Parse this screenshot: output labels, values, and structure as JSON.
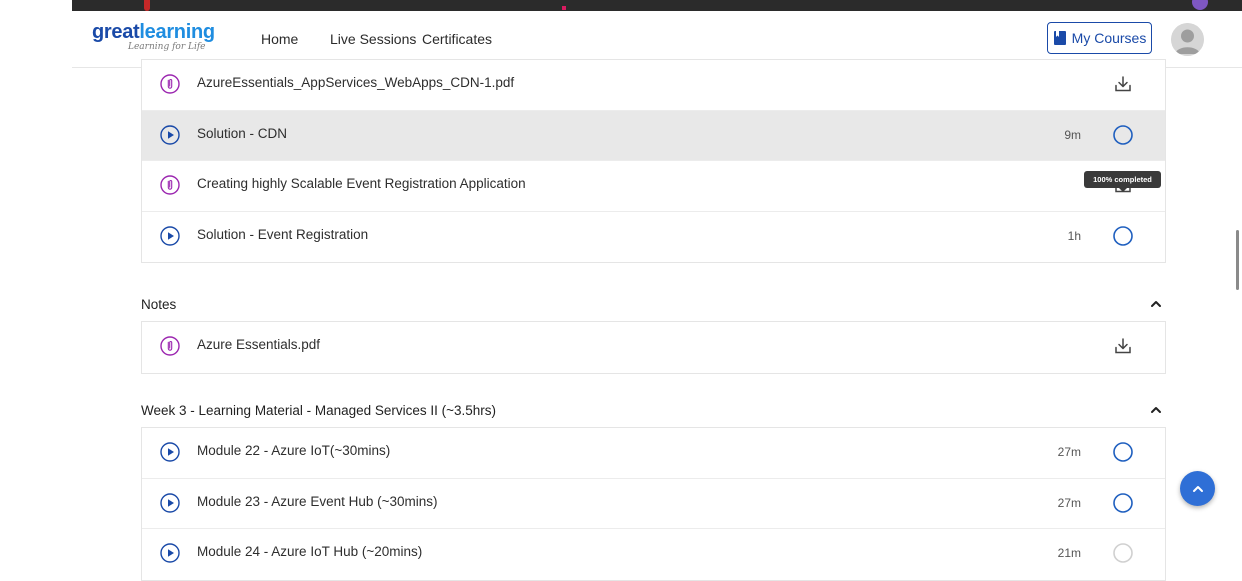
{
  "nav": {
    "logo_main_a": "great",
    "logo_main_b": "learning",
    "logo_tagline": "Learning for Life",
    "links": [
      "Home",
      "Live Sessions",
      "Certificates"
    ],
    "my_courses_label": "My Courses"
  },
  "colors": {
    "brand_dark": "#1a4aa8",
    "brand_light": "#1f8de0",
    "play_icon": "#1a4aa8",
    "attachment_icon": "#9c27b0",
    "status_ring": "#1f5fbf",
    "fab": "#2f6fd6"
  },
  "top_items": [
    {
      "type": "attachment",
      "icon": "paperclip-icon",
      "title": "AzureEssentials_AppServices_WebApps_CDN-1.pdf",
      "duration": "",
      "action": "download-icon"
    },
    {
      "type": "video",
      "icon": "play-icon",
      "title": "Solution - CDN",
      "duration": "9m",
      "action": "status-circle-icon",
      "highlighted": true
    },
    {
      "type": "attachment",
      "icon": "paperclip-icon",
      "title": "Creating highly Scalable Event Registration Application",
      "duration": "",
      "action": "download-icon"
    },
    {
      "type": "video",
      "icon": "play-icon",
      "title": "Solution - Event Registration",
      "duration": "1h",
      "action": "status-circle-icon"
    }
  ],
  "tooltip": "100% completed",
  "notes_section": {
    "label": "Notes",
    "items": [
      {
        "type": "attachment",
        "icon": "paperclip-icon",
        "title": "Azure Essentials.pdf",
        "action": "download-icon"
      }
    ]
  },
  "week3_section": {
    "label": "Week 3 - Learning Material - Managed Services II (~3.5hrs)",
    "items": [
      {
        "type": "video",
        "icon": "play-icon",
        "title": "Module 22 - Azure IoT(~30mins)",
        "duration": "27m"
      },
      {
        "type": "video",
        "icon": "play-icon",
        "title": "Module 23 - Azure Event Hub (~30mins)",
        "duration": "27m"
      },
      {
        "type": "video",
        "icon": "play-icon",
        "title": "Module 24 - Azure IoT Hub (~20mins)",
        "duration": "21m"
      }
    ]
  }
}
